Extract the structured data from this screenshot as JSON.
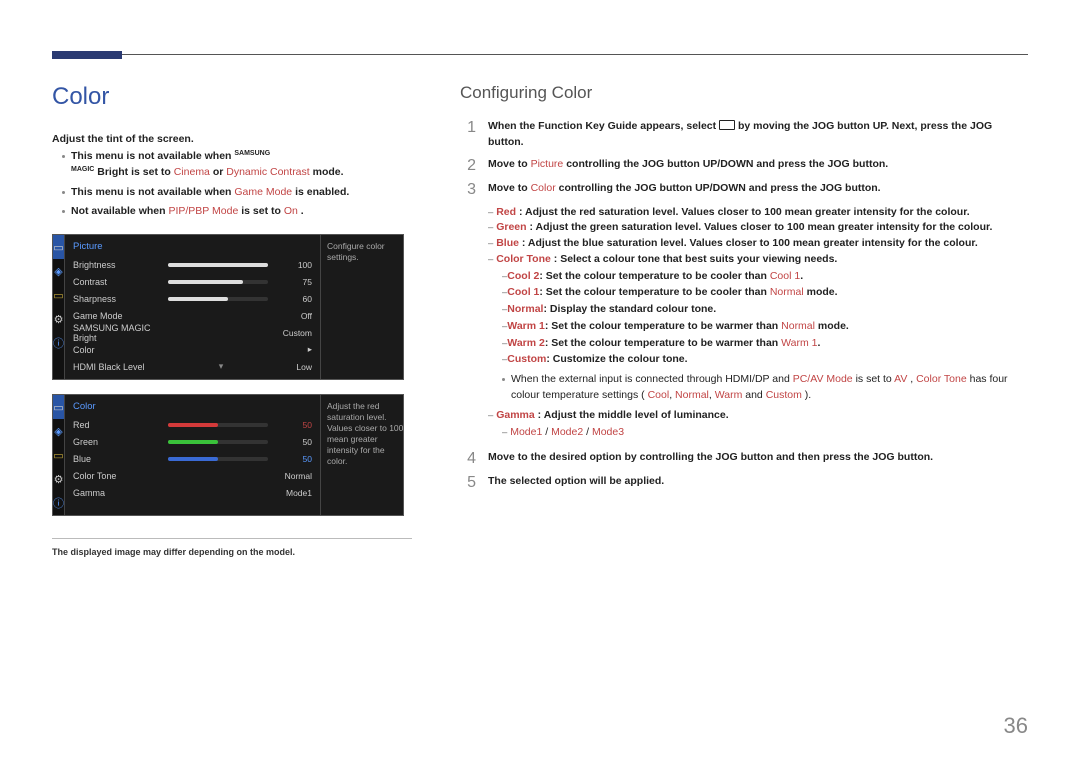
{
  "header": {
    "title": "Color"
  },
  "left": {
    "intro": "Adjust the tint of the screen.",
    "notes": [
      {
        "pre": "This menu is not available when ",
        "brand": "SAMSUNG MAGIC Bright",
        "post": " is set to ",
        "opt1": "Cinema",
        "mid": " or ",
        "opt2": "Dynamic Contrast",
        "tail": " mode."
      },
      {
        "pre": "This menu is not available when ",
        "opt1": "Game Mode",
        "post": " is enabled."
      },
      {
        "pre": "Not available when ",
        "opt1": "PIP/PBP Mode",
        "post": " is set to ",
        "opt2": "On",
        "tail": "."
      }
    ],
    "osd1": {
      "title": "Picture",
      "side": "Configure color settings.",
      "rows": [
        {
          "label": "Brightness",
          "value": "100",
          "fill": 100
        },
        {
          "label": "Contrast",
          "value": "75",
          "fill": 75
        },
        {
          "label": "Sharpness",
          "value": "60",
          "fill": 60
        },
        {
          "label": "Game Mode",
          "value": "Off"
        },
        {
          "label": "SAMSUNG MAGIC Bright",
          "value": "Custom"
        },
        {
          "label": "Color",
          "value": "▸"
        },
        {
          "label": "HDMI Black Level",
          "value": "Low",
          "caret": "▾"
        }
      ]
    },
    "osd2": {
      "title": "Color",
      "side": "Adjust the red saturation level. Values closer to 100 mean greater intensity for the color.",
      "rows": [
        {
          "label": "Red",
          "value": "50",
          "fill": 50,
          "color": "#d43a3a",
          "valColor": "#c14545"
        },
        {
          "label": "Green",
          "value": "50",
          "fill": 50,
          "color": "#3ac23a"
        },
        {
          "label": "Blue",
          "value": "50",
          "fill": 50,
          "color": "#3a6ad4",
          "valColor": "#5a9aff"
        },
        {
          "label": "Color Tone",
          "value": "Normal"
        },
        {
          "label": "Gamma",
          "value": "Mode1"
        }
      ]
    },
    "footnote": "The displayed image may differ depending on the model."
  },
  "right": {
    "heading": "Configuring Color",
    "steps": {
      "s1": {
        "pre": "When the Function Key Guide appears, select ",
        "post": " by moving the JOG button UP. Next, press the JOG button."
      },
      "s2": {
        "pre": "Move to ",
        "target": "Picture",
        "post": " controlling the JOG button UP/DOWN and press the JOG button."
      },
      "s3": {
        "pre": "Move to ",
        "target": "Color",
        "post": " controlling the JOG button UP/DOWN and press the JOG button."
      },
      "s4": "Move to the desired option by controlling the JOG button and then press the JOG button.",
      "s5": "The selected option will be applied."
    },
    "details": {
      "red": {
        "key": "Red",
        "text": ": Adjust the red saturation level. Values closer to 100 mean greater intensity for the colour."
      },
      "green": {
        "key": "Green",
        "text": ": Adjust the green saturation level. Values closer to 100 mean greater intensity for the colour."
      },
      "blue": {
        "key": "Blue",
        "text": ": Adjust the blue saturation level. Values closer to 100 mean greater intensity for the colour."
      },
      "colortone": {
        "key": "Color Tone",
        "text": ": Select a colour tone that best suits your viewing needs.",
        "subs": [
          {
            "k": "Cool 2",
            "t": ": Set the colour temperature to be cooler than ",
            "ref": "Cool 1",
            "tail": "."
          },
          {
            "k": "Cool 1",
            "t": ": Set the colour temperature to be cooler than ",
            "ref": "Normal",
            "tail": " mode."
          },
          {
            "k": "Normal",
            "t": ": Display the standard colour tone."
          },
          {
            "k": "Warm 1",
            "t": ": Set the colour temperature to be warmer than ",
            "ref": "Normal",
            "tail": " mode."
          },
          {
            "k": "Warm 2",
            "t": ": Set the colour temperature to be warmer than ",
            "ref": "Warm 1",
            "tail": "."
          },
          {
            "k": "Custom",
            "t": ": Customize the colour tone."
          }
        ],
        "note": {
          "pre": "When the external input is connected through HDMI/DP and ",
          "k1": "PC/AV Mode",
          "mid": " is set to ",
          "k2": "AV",
          "mid2": ", ",
          "k3": "Color Tone",
          "post": " has four colour temperature settings (",
          "o1": "Cool",
          "o2": "Normal",
          "o3": "Warm",
          "o4": "Custom",
          "tail": ")."
        }
      },
      "gamma": {
        "key": "Gamma",
        "text": ": Adjust the middle level of luminance.",
        "opts": {
          "a": "Mode1",
          "b": "Mode2",
          "c": "Mode3",
          "sep": " / "
        }
      }
    }
  },
  "pageNumber": "36"
}
